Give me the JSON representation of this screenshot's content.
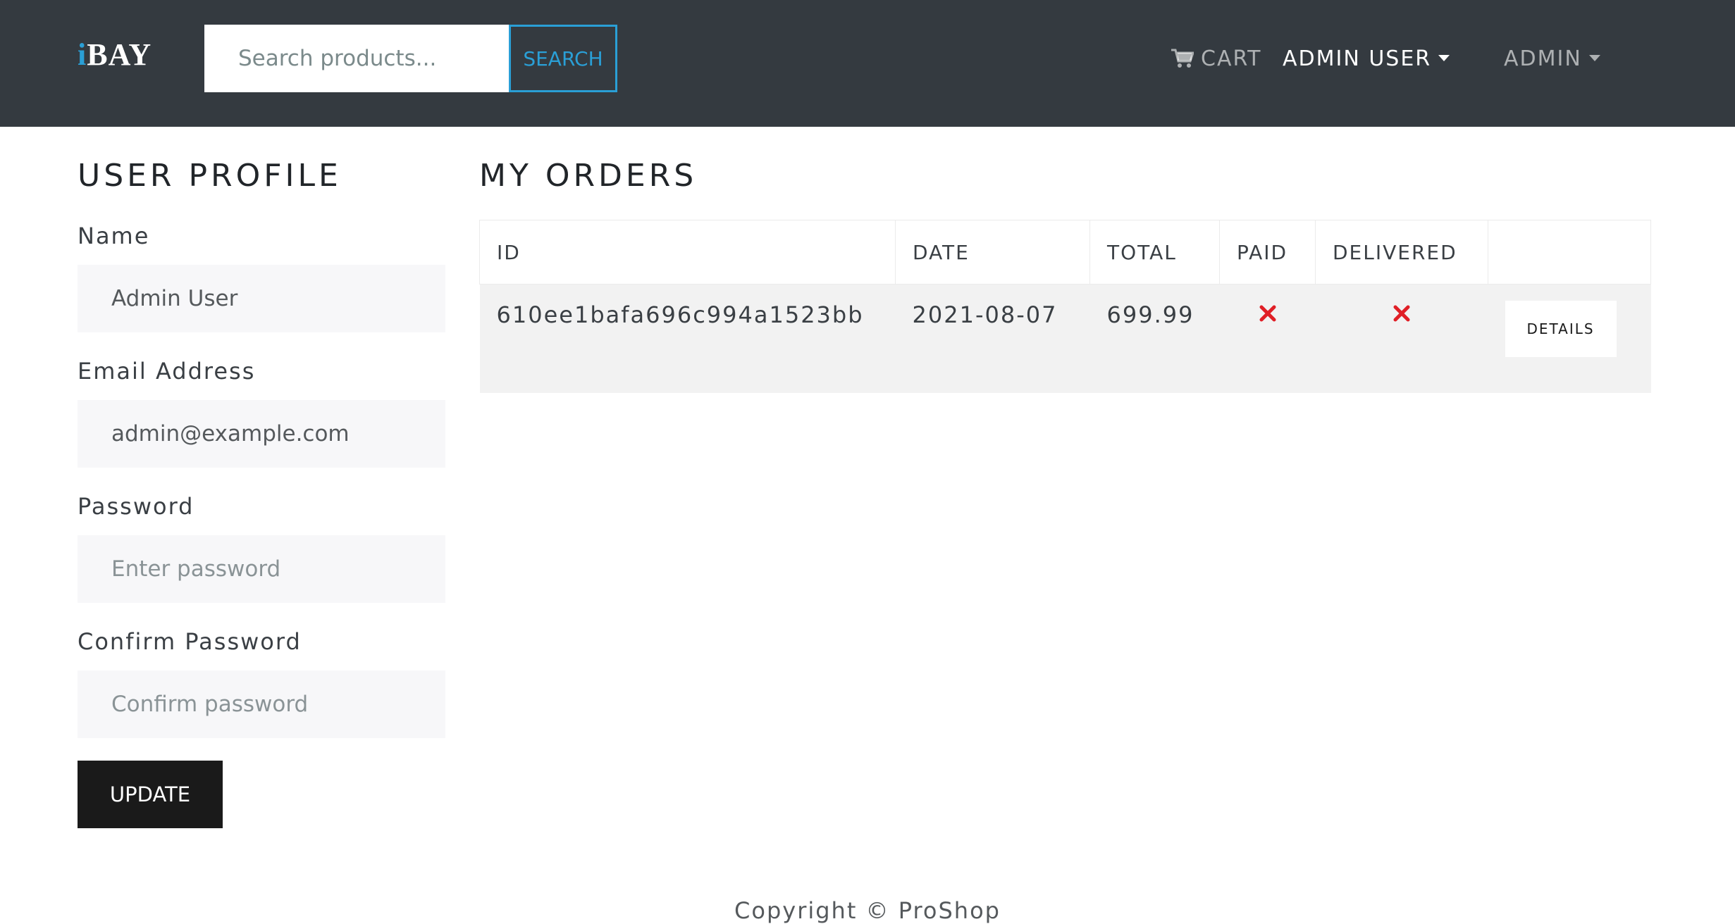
{
  "navbar": {
    "brand_accent": "i",
    "brand_rest": "BAY",
    "search": {
      "placeholder": "Search products...",
      "value": "",
      "button_label": "SEARCH"
    },
    "cart_label": "CART",
    "cart_icon": "shopping-cart-icon",
    "user_menu_label": "ADMIN USER",
    "admin_menu_label": "ADMIN"
  },
  "profile": {
    "title": "USER PROFILE",
    "name_label": "Name",
    "name_value": "Admin User",
    "email_label": "Email Address",
    "email_value": "admin@example.com",
    "password_label": "Password",
    "password_placeholder": "Enter password",
    "confirm_label": "Confirm Password",
    "confirm_placeholder": "Confirm password",
    "update_label": "UPDATE"
  },
  "orders": {
    "title": "MY ORDERS",
    "columns": [
      "ID",
      "DATE",
      "TOTAL",
      "PAID",
      "DELIVERED",
      ""
    ],
    "rows": [
      {
        "id": "610ee1bafa696c994a1523bb",
        "date": "2021-08-07",
        "total": "699.99",
        "paid_icon": "x-icon",
        "delivered_icon": "x-icon",
        "details_label": "DETAILS"
      }
    ]
  },
  "footer": {
    "text": "Copyright © ProShop"
  },
  "colors": {
    "navbar_bg": "#343a40",
    "accent": "#2a9fd6",
    "not_status": "#e01f26",
    "input_bg": "#f7f7f9",
    "row_bg": "#f2f2f2",
    "button_dark": "#1a1a1a"
  }
}
